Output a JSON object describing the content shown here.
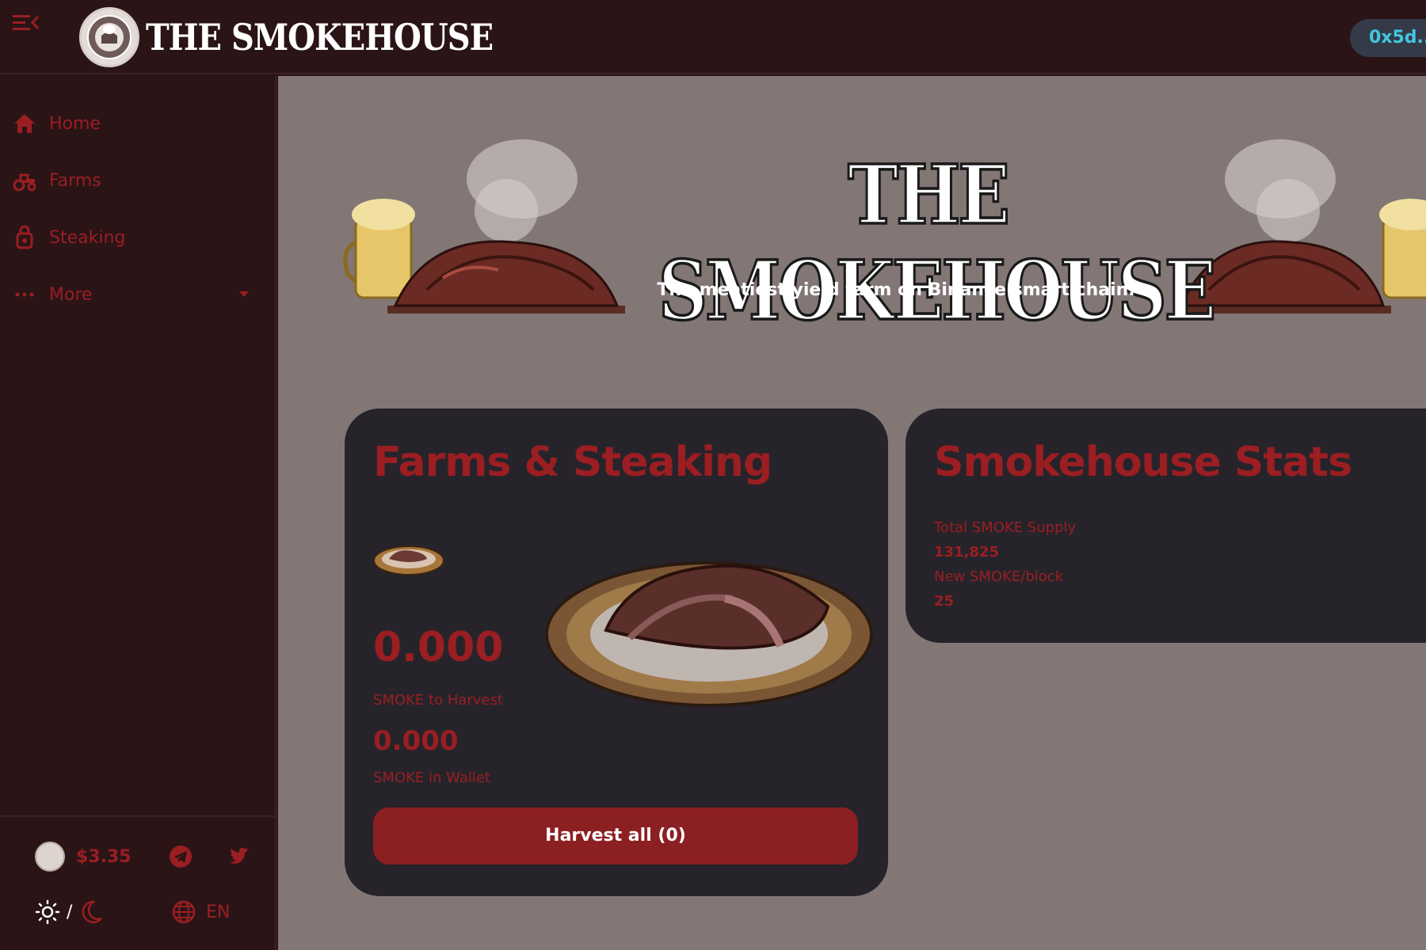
{
  "header": {
    "brand_name": "THE SMOKEHOUSE",
    "wallet_address": "0x5d..."
  },
  "sidebar": {
    "items": [
      {
        "label": "Home",
        "icon": "home-icon"
      },
      {
        "label": "Farms",
        "icon": "tractor-icon"
      },
      {
        "label": "Steaking",
        "icon": "lock-icon"
      },
      {
        "label": "More",
        "icon": "more-icon"
      }
    ],
    "footer": {
      "price": "$3.35",
      "theme_separator": "/",
      "language": "EN"
    }
  },
  "hero": {
    "title": "THE SMOKEHOUSE",
    "subtitle": "The meatiest yield farm on Binance smart chain."
  },
  "farms_card": {
    "title": "Farms & Steaking",
    "harvest_value": "0.000",
    "harvest_label": "SMOKE to Harvest",
    "wallet_value": "0.000",
    "wallet_label": "SMOKE in Wallet",
    "harvest_button": "Harvest all (0)"
  },
  "stats_card": {
    "title": "Smokehouse Stats",
    "total_supply_label": "Total SMOKE Supply",
    "total_supply_value": "131,825",
    "per_block_label": "New SMOKE/block",
    "per_block_value": "25"
  },
  "colors": {
    "accent": "#9a1e22",
    "background": "#2a1416",
    "main_bg": "#827775",
    "card_bg": "#26242a",
    "wallet_text": "#3fc8e0"
  }
}
